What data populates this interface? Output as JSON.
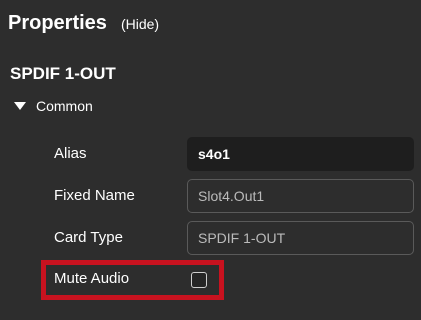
{
  "header": {
    "title": "Properties",
    "hide_label": "(Hide)"
  },
  "device": {
    "name": "SPDIF 1-OUT"
  },
  "section": {
    "label": "Common",
    "expanded": true,
    "icon": "triangle-down-icon"
  },
  "fields": {
    "alias": {
      "label": "Alias",
      "value": "s4o1"
    },
    "fixed_name": {
      "label": "Fixed Name",
      "value": "Slot4.Out1"
    },
    "card_type": {
      "label": "Card Type",
      "value": "SPDIF 1-OUT"
    }
  },
  "mute_audio": {
    "label": "Mute Audio",
    "checked": false
  },
  "colors": {
    "background": "#2d2d2d",
    "input_active": "#1e1e1e",
    "input_border": "#5a5a5a",
    "highlight": "#c8121f"
  }
}
